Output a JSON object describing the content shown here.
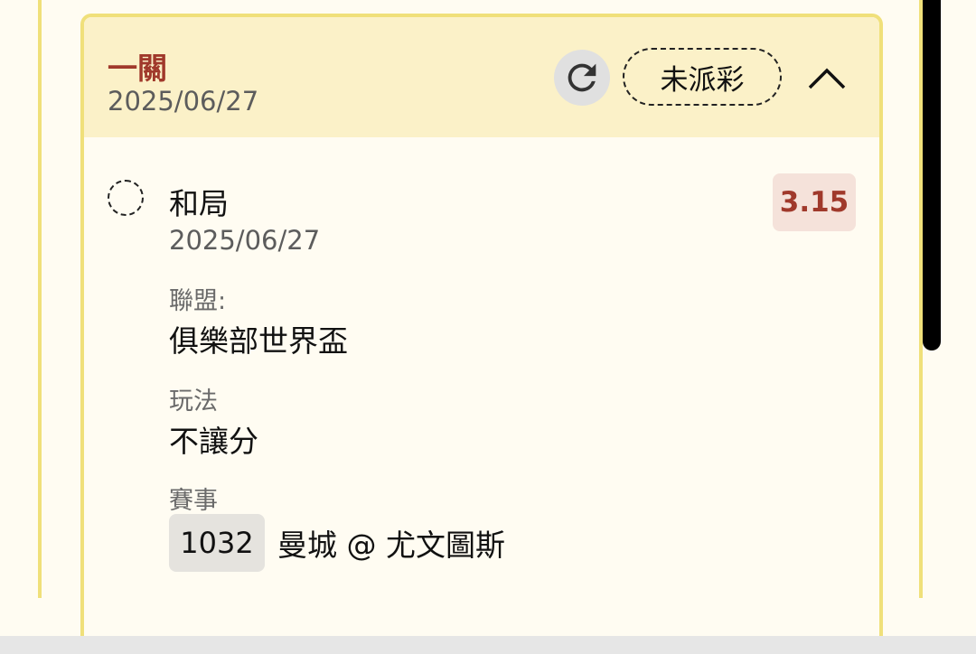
{
  "card": {
    "title": "一關",
    "date": "2025/06/27",
    "status": "未派彩"
  },
  "selection": {
    "name": "和局",
    "date": "2025/06/27",
    "odds": "3.15",
    "league_label": "聯盟:",
    "league": "俱樂部世界盃",
    "bet_type_label": "玩法",
    "bet_type": "不讓分",
    "match_label": "賽事",
    "match_no": "1032",
    "match_name": "曼城 @ 尤文圖斯"
  },
  "icons": {
    "refresh": "refresh-icon",
    "collapse": "chevron-up-icon",
    "radio": "radio-unchecked-icon"
  },
  "colors": {
    "accent_red": "#a0392b",
    "card_border": "#f0e07a",
    "header_bg": "#fbf1c8",
    "odds_bg": "#f5e2da"
  }
}
